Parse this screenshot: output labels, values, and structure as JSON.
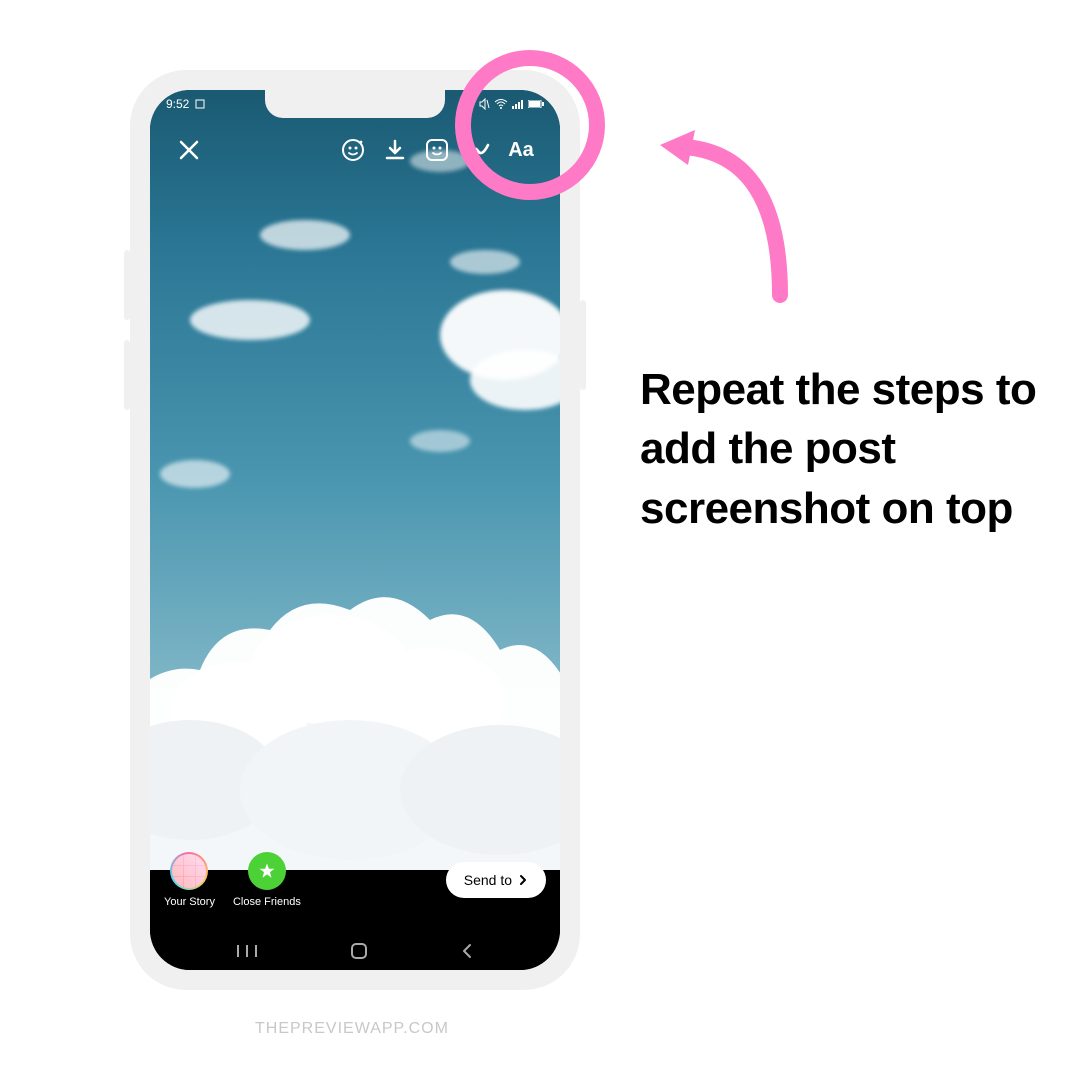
{
  "status": {
    "time": "9:52"
  },
  "toolbar": {
    "text_label": "Aa"
  },
  "share": {
    "your_story": "Your Story",
    "close_friends": "Close Friends",
    "send_to": "Send to"
  },
  "instruction": "Repeat the steps to add the post screenshot on top",
  "watermark": "THEPREVIEWAPP.COM",
  "colors": {
    "accent_pink": "#ff7ac6",
    "close_friends_green": "#4cd137"
  }
}
